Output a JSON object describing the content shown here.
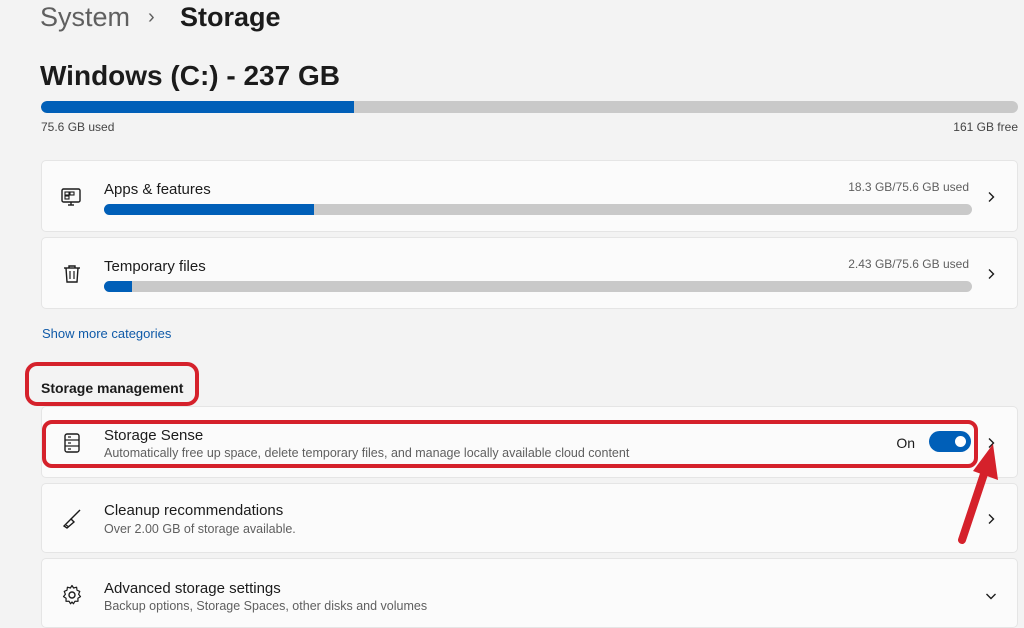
{
  "breadcrumb": {
    "parent": "System",
    "separator": "›",
    "current": "Storage"
  },
  "drive": {
    "title": "Windows (C:) - 237 GB",
    "used_label": "75.6 GB used",
    "free_label": "161 GB free",
    "used_fraction": 0.32
  },
  "categories": [
    {
      "icon": "apps-icon",
      "title": "Apps & features",
      "size": "18.3 GB/75.6 GB used",
      "fraction": 0.242
    },
    {
      "icon": "trash-icon",
      "title": "Temporary files",
      "size": "2.43 GB/75.6 GB used",
      "fraction": 0.032
    }
  ],
  "show_more": "Show more categories",
  "storage_management": {
    "title": "Storage management",
    "storage_sense": {
      "title": "Storage Sense",
      "subtitle": "Automatically free up space, delete temporary files, and manage locally available cloud content",
      "toggle_label": "On",
      "toggle_state": true
    },
    "cleanup": {
      "title": "Cleanup recommendations",
      "subtitle": "Over 2.00 GB of storage available."
    },
    "advanced": {
      "title": "Advanced storage settings",
      "subtitle": "Backup options, Storage Spaces, other disks and volumes"
    }
  },
  "colors": {
    "accent": "#005fb8",
    "highlight": "#d5212b"
  }
}
